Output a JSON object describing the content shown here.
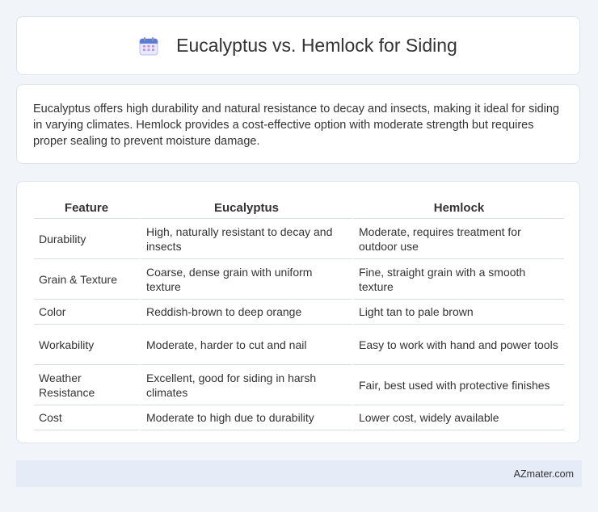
{
  "header": {
    "icon": "calendar-icon",
    "title": "Eucalyptus vs. Hemlock for Siding"
  },
  "intro": {
    "text": "Eucalyptus offers high durability and natural resistance to decay and insects, making it ideal for siding in varying climates. Hemlock provides a cost-effective option with moderate strength but requires proper sealing to prevent moisture damage."
  },
  "table": {
    "headers": [
      "Feature",
      "Eucalyptus",
      "Hemlock"
    ],
    "rows": [
      [
        "Durability",
        "High, naturally resistant to decay and insects",
        "Moderate, requires treatment for outdoor use"
      ],
      [
        "Grain & Texture",
        "Coarse, dense grain with uniform texture",
        "Fine, straight grain with a smooth texture"
      ],
      [
        "Color",
        "Reddish-brown to deep orange",
        "Light tan to pale brown"
      ],
      [
        "Workability",
        "Moderate, harder to cut and nail",
        "Easy to work with hand and power tools"
      ],
      [
        "Weather Resistance",
        "Excellent, good for siding in harsh climates",
        "Fair, best used with protective finishes"
      ],
      [
        "Cost",
        "Moderate to high due to durability",
        "Lower cost, widely available"
      ]
    ]
  },
  "footer": {
    "text": "AZmater.com"
  },
  "colors": {
    "background": "#f1f4f9",
    "card": "#ffffff",
    "footer_bg": "#e6ecf7",
    "icon_accent": "#5b7bd5"
  }
}
